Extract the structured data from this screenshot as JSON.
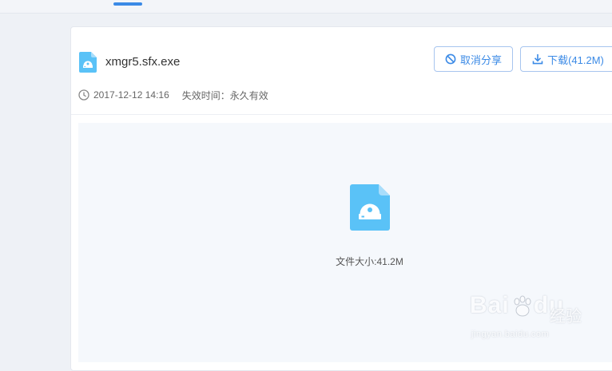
{
  "colors": {
    "accent": "#3b8ae6",
    "file_icon": "#5ac2f7",
    "button_border": "#a7c5ef"
  },
  "file": {
    "name": "xmgr5.sfx.exe",
    "date": "2017-12-12 14:16",
    "expire": "失效时间：永久有效",
    "size_text": "文件大小:41.2M",
    "icon": "file-exe-icon"
  },
  "actions": {
    "cancel_label": "取消分享",
    "cancel_icon": "ban-icon",
    "download_label": "下载(41.2M)",
    "download_icon": "download-icon"
  },
  "watermark": {
    "brand": "Bai",
    "brand_tail": "du",
    "sub": "经验",
    "url": "jingyan.baidu.com"
  }
}
